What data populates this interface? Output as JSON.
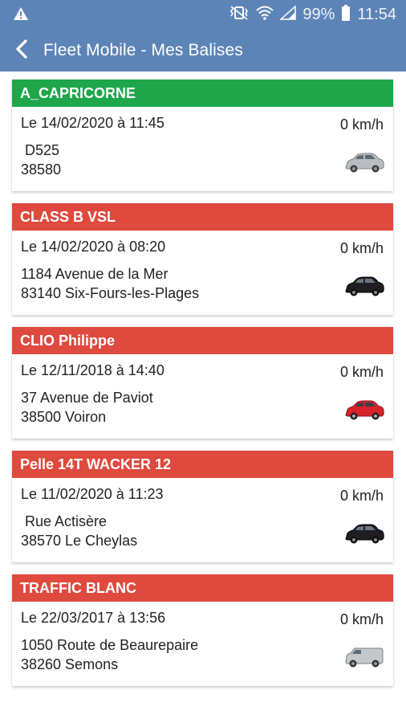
{
  "status_bar": {
    "battery": "99%",
    "time": "11:54",
    "icons": [
      "warning-icon",
      "vibrate-icon",
      "wifi-icon",
      "signal-icon",
      "battery-icon"
    ]
  },
  "app_bar": {
    "title": "Fleet Mobile - Mes Balises",
    "back_icon": "chevron-left-icon"
  },
  "colors": {
    "primary": "#5d84b7",
    "status_ok": "#1fa64a",
    "status_alert": "#df4a3e"
  },
  "beacons": [
    {
      "name": "A_CAPRICORNE",
      "status": "ok",
      "date": "Le 14/02/2020 à 11:45",
      "speed": "0 km/h",
      "address_line1": " D525",
      "address_line2": "38580",
      "vehicle_icon": "silver-car-icon"
    },
    {
      "name": "CLASS B VSL",
      "status": "alert",
      "date": "Le 14/02/2020 à 08:20",
      "speed": "0 km/h",
      "address_line1": "1184 Avenue de la Mer",
      "address_line2": "83140 Six-Fours-les-Plages",
      "vehicle_icon": "black-car-icon"
    },
    {
      "name": "CLIO Philippe",
      "status": "alert",
      "date": "Le 12/11/2018 à 14:40",
      "speed": "0 km/h",
      "address_line1": "37 Avenue de Paviot",
      "address_line2": "38500 Voiron",
      "vehicle_icon": "red-car-icon"
    },
    {
      "name": "Pelle 14T WACKER 12",
      "status": "alert",
      "date": "Le 11/02/2020 à 11:23",
      "speed": "0 km/h",
      "address_line1": " Rue Actisère",
      "address_line2": "38570 Le Cheylas",
      "vehicle_icon": "black-car-icon"
    },
    {
      "name": "TRAFFIC BLANC",
      "status": "alert",
      "date": "Le 22/03/2017 à 13:56",
      "speed": "0 km/h",
      "address_line1": "1050 Route de Beaurepaire",
      "address_line2": "38260 Semons",
      "vehicle_icon": "silver-van-icon"
    }
  ]
}
